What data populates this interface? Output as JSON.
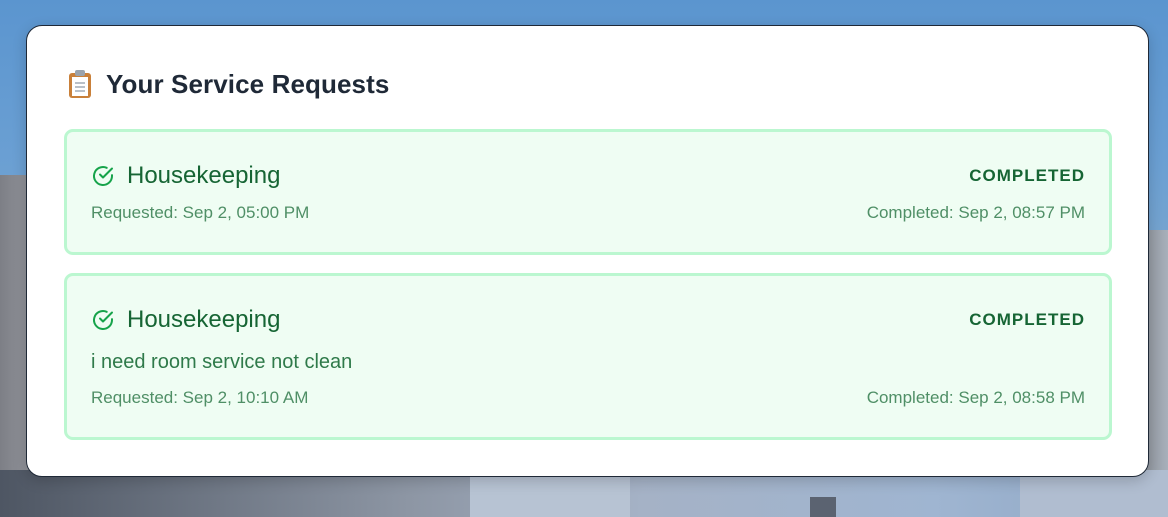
{
  "panel": {
    "title": "Your Service Requests",
    "title_icon": "clipboard-icon"
  },
  "requests": [
    {
      "service_type": "Housekeeping",
      "status": "COMPLETED",
      "status_icon": "check-circle-icon",
      "note": "",
      "requested": "Requested: Sep 2, 05:00 PM",
      "completed": "Completed: Sep 2, 08:57 PM"
    },
    {
      "service_type": "Housekeeping",
      "status": "COMPLETED",
      "status_icon": "check-circle-icon",
      "note": "i need room service not clean",
      "requested": "Requested: Sep 2, 10:10 AM",
      "completed": "Completed: Sep 2, 08:58 PM"
    }
  ],
  "colors": {
    "card_background": "#effdf3",
    "card_border": "#bbf7d0",
    "success_text": "#166534",
    "meta_text": "#4f8f66",
    "title_text": "#1f2937"
  }
}
